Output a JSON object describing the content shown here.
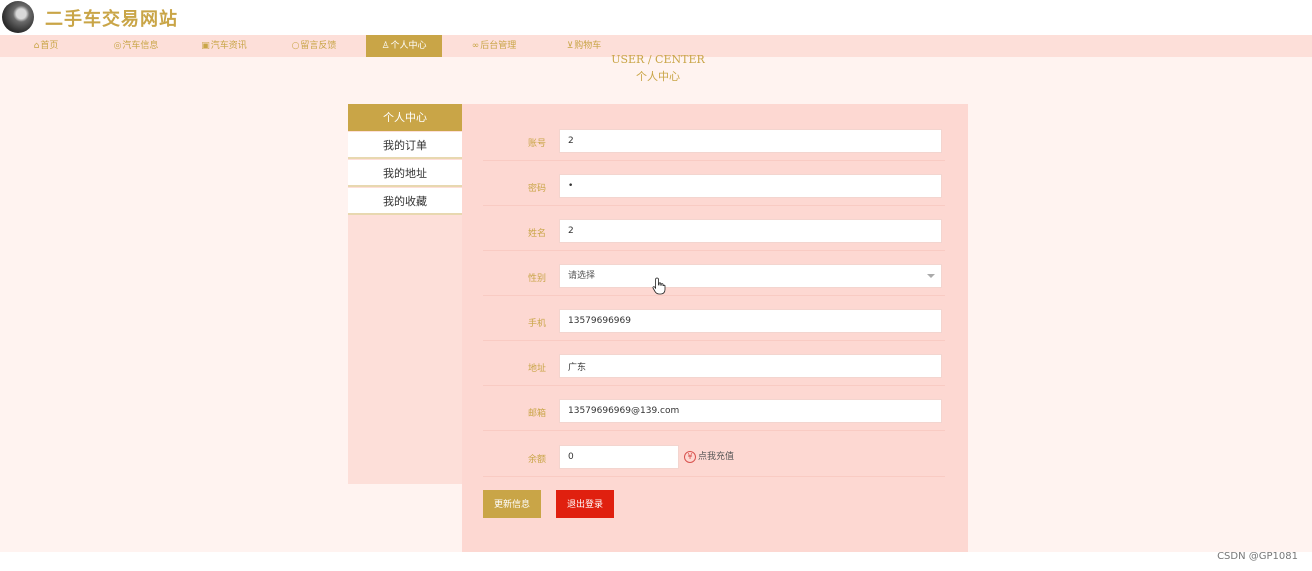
{
  "header": {
    "logo_icon": "car-photo-avatar",
    "site_title": "二手车交易网站"
  },
  "nav": {
    "items": [
      {
        "label": "首页",
        "icon": "home-icon",
        "glyph": "⌂"
      },
      {
        "label": "汽车信息",
        "icon": "car-icon",
        "glyph": "◎"
      },
      {
        "label": "汽车资讯",
        "icon": "news-icon",
        "glyph": "▣"
      },
      {
        "label": "留言反馈",
        "icon": "message-icon",
        "glyph": "○"
      },
      {
        "label": "个人中心",
        "icon": "user-icon",
        "glyph": "♙",
        "active": true
      },
      {
        "label": "后台管理",
        "icon": "link-icon",
        "glyph": "∞"
      },
      {
        "label": "购物车",
        "icon": "cart-icon",
        "glyph": "⊻"
      }
    ]
  },
  "section": {
    "title_en": "USER / CENTER",
    "title_cn": "个人中心"
  },
  "side_menu": {
    "header": "个人中心",
    "items": [
      "我的订单",
      "我的地址",
      "我的收藏"
    ]
  },
  "form": {
    "account": {
      "label": "账号",
      "value": "2"
    },
    "password": {
      "label": "密码",
      "value": "•"
    },
    "name": {
      "label": "姓名",
      "value": "2"
    },
    "gender": {
      "label": "性别",
      "value": "请选择"
    },
    "phone": {
      "label": "手机",
      "value": "13579696969"
    },
    "address": {
      "label": "地址",
      "value": "广东"
    },
    "email": {
      "label": "邮箱",
      "value": "13579696969@139.com"
    },
    "balance": {
      "label": "余额",
      "value": "0"
    },
    "recharge_label": "点我充值",
    "update_button": "更新信息",
    "logout_button": "退出登录"
  },
  "watermark": "CSDN @GP1081",
  "colors": {
    "accent": "#c9a547",
    "nav_bg": "#fddfd9",
    "page_bg": "#fff3f0",
    "panel_bg": "#fdd8d2",
    "logout": "#e0200f"
  }
}
